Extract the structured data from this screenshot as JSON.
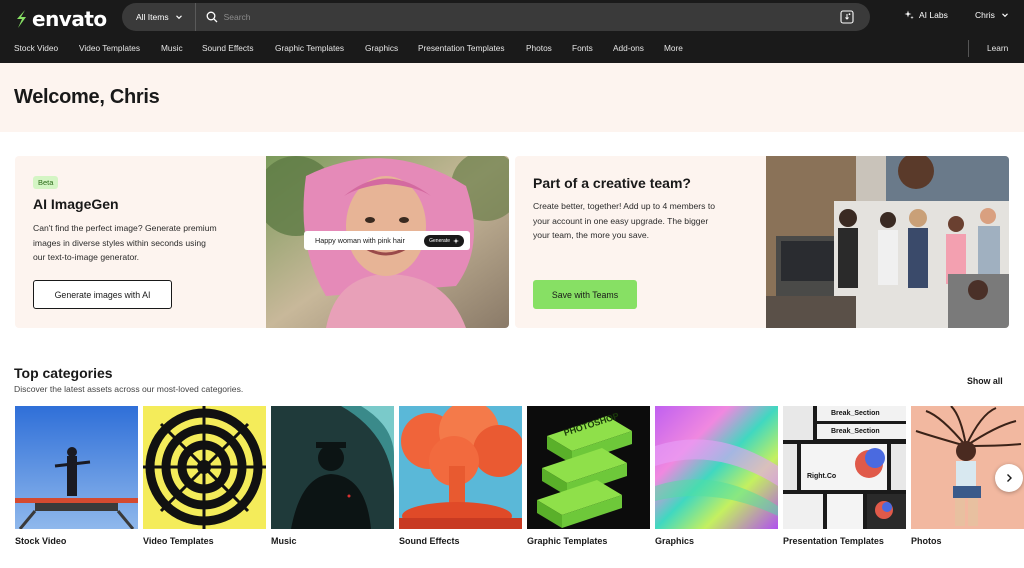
{
  "brand": {
    "name": "envato",
    "accent": "#87e064"
  },
  "header": {
    "scope_label": "All Items",
    "search_placeholder": "Search",
    "ai_labs_label": "AI Labs",
    "user_label": "Chris"
  },
  "nav": {
    "items": [
      {
        "label": "Stock Video"
      },
      {
        "label": "Video Templates"
      },
      {
        "label": "Music"
      },
      {
        "label": "Sound Effects"
      },
      {
        "label": "Graphic Templates"
      },
      {
        "label": "Graphics"
      },
      {
        "label": "Presentation Templates"
      },
      {
        "label": "Photos"
      },
      {
        "label": "Fonts"
      },
      {
        "label": "Add-ons"
      },
      {
        "label": "More"
      }
    ],
    "learn_label": "Learn"
  },
  "welcome": {
    "title": "Welcome, Chris"
  },
  "promo_imagegen": {
    "badge": "Beta",
    "title": "AI ImageGen",
    "text_lines": [
      "Can't find the perfect image? Generate premium",
      "images in diverse styles within seconds using",
      "our text-to-image generator."
    ],
    "button": "Generate images with AI",
    "prompt_text": "Happy woman with pink hair",
    "prompt_button": "Generate"
  },
  "promo_teams": {
    "title": "Part of a creative team?",
    "text_lines": [
      "Create better, together! Add up to 4 members to",
      "your account in one easy upgrade. The bigger",
      "your team, the more you save."
    ],
    "button": "Save with Teams"
  },
  "categories": {
    "title": "Top categories",
    "subtitle": "Discover the latest assets across our most-loved categories.",
    "show_all": "Show all",
    "items": [
      {
        "label": "Stock Video"
      },
      {
        "label": "Video Templates"
      },
      {
        "label": "Music"
      },
      {
        "label": "Sound Effects"
      },
      {
        "label": "Graphic Templates"
      },
      {
        "label": "Graphics"
      },
      {
        "label": "Presentation Templates"
      },
      {
        "label": "Photos"
      }
    ],
    "tile_text": {
      "graphic_1": "PHOTOSHOP",
      "presentation_1": "Break_Section",
      "presentation_2": "Break_Section",
      "presentation_3": "Right.Co"
    }
  }
}
